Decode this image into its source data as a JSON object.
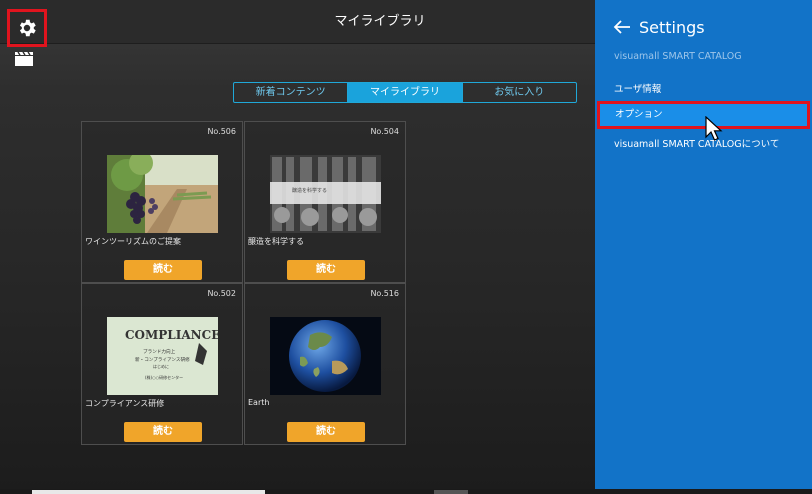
{
  "app": {
    "title": "マイライブラリ",
    "tabs": [
      {
        "label": "新着コンテンツ",
        "active": false
      },
      {
        "label": "マイライブラリ",
        "active": true
      },
      {
        "label": "お気に入り",
        "active": false
      }
    ],
    "cards": [
      {
        "number": "No.506",
        "title": "ワインツーリズムのご提案",
        "read_label": "読む",
        "thumb": "vineyard"
      },
      {
        "number": "No.504",
        "title": "醸造を科学する",
        "read_label": "読む",
        "thumb": "brewery"
      },
      {
        "number": "No.502",
        "title": "コンプライアンス研修",
        "read_label": "読む",
        "thumb": "compliance"
      },
      {
        "number": "No.516",
        "title": "Earth",
        "read_label": "読む",
        "thumb": "earth"
      }
    ],
    "thumb_text": {
      "brewery_caption": "醸造を科学する",
      "compliance_heading": "COMPLIANCE",
      "compliance_lines": [
        "ブランド力向上",
        "新・コンプライアンス研修",
        "はじめに",
        "(株)○○研修センター"
      ]
    }
  },
  "settings": {
    "title": "Settings",
    "subtitle": "visuamall SMART CATALOG",
    "items": [
      {
        "label": "ユーザ情報",
        "selected": false
      },
      {
        "label": "オプション",
        "selected": true
      },
      {
        "label": "visuamall SMART CATALOGについて",
        "selected": false
      }
    ]
  },
  "colors": {
    "accent": "#1aa3dc",
    "settings_bg": "#1273c8",
    "read_button": "#f0a52a",
    "highlight": "#e0141e"
  },
  "icons": {
    "settings": "gear-icon",
    "library": "clapperboard-icon",
    "back": "back-arrow-icon",
    "cursor": "mouse-cursor-icon"
  }
}
